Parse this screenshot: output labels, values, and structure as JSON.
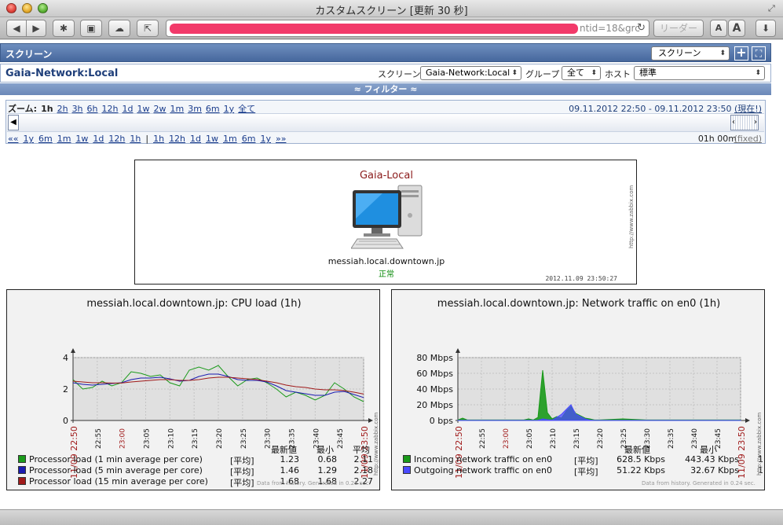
{
  "window": {
    "title": "カスタムスクリーン [更新 30 秒]"
  },
  "toolbar": {
    "back": "◀",
    "forward": "▶",
    "address_visible": "ntid=18&grc",
    "reader_label": "リーダー",
    "font_small": "A",
    "font_large": "A"
  },
  "header": {
    "title": "スクリーン",
    "screen_select": "スクリーン",
    "add_label": "+"
  },
  "filter": {
    "screen_name": "Gaia-Network:Local",
    "screen_label": "スクリーン",
    "screen_value": "Gaia-Network:Local",
    "group_label": "グループ",
    "group_value": "全て",
    "host_label": "ホスト",
    "host_value": "標準",
    "toggle_label": "≈ フィルター ≈"
  },
  "timebar": {
    "zoom_label": "ズーム:",
    "zoom_links": [
      "1h",
      "2h",
      "3h",
      "6h",
      "12h",
      "1d",
      "1w",
      "2w",
      "1m",
      "3m",
      "6m",
      "1y",
      "全て"
    ],
    "zoom_active": "1h",
    "range_start": "09.11.2012 22:50",
    "range_sep": "-",
    "range_end": "09.11.2012 23:50",
    "range_now": "(現在!)",
    "nav_left_start": "««",
    "nav_left": [
      "1y",
      "6m",
      "1m",
      "1w",
      "1d",
      "12h",
      "1h"
    ],
    "nav_sep": "|",
    "nav_right": [
      "1h",
      "12h",
      "1d",
      "1w",
      "1m",
      "6m",
      "1y"
    ],
    "nav_right_end": "»»",
    "period": "01h 00m",
    "fixed": "(fixed)"
  },
  "map": {
    "title": "Gaia-Local",
    "host": "messiah.local.downtown.jp",
    "status": "正常",
    "timestamp": "2012.11.09 23:50:27",
    "watermark": "http://www.zabbix.com"
  },
  "cpu_graph": {
    "title": "messiah.local.downtown.jp: CPU load (1h)",
    "col_last": "最新値",
    "col_min": "最小",
    "col_avg": "平均",
    "footer": "Data from history. Generated in 0.26 sec.",
    "watermark": "http://www.zabbix.com",
    "start_label": "11/09 22:50",
    "end_label": "11/09 23:50",
    "legend": [
      {
        "name": "Processor load (1 min average per core)",
        "func": "[平均]",
        "last": "1.23",
        "min": "0.68",
        "avg": "2.11",
        "color": "#1a9a1a"
      },
      {
        "name": "Processor load (5 min average per core)",
        "func": "[平均]",
        "last": "1.46",
        "min": "1.29",
        "avg": "2.18",
        "color": "#1a1ab0"
      },
      {
        "name": "Processor load (15 min average per core)",
        "func": "[平均]",
        "last": "1.68",
        "min": "1.68",
        "avg": "2.27",
        "color": "#a01a1a"
      }
    ]
  },
  "net_graph": {
    "title": "messiah.local.downtown.jp: Network traffic on en0 (1h)",
    "col_last": "最新値",
    "col_min": "最小",
    "footer": "Data from history. Generated in 0.24 sec.",
    "watermark": "http://www.zabbix.com",
    "start_label": "11/09 22:50",
    "end_label": "11/09 23:50",
    "legend": [
      {
        "name": "Incoming network traffic on en0",
        "func": "[平均]",
        "last": "628.5 Kbps",
        "min": "443.43 Kbps",
        "extra": "1",
        "color": "#1a9a1a"
      },
      {
        "name": "Outgoing network traffic on en0",
        "func": "[平均]",
        "last": "51.22 Kbps",
        "min": "32.67 Kbps",
        "extra": "1.",
        "color": "#4a4aff"
      }
    ]
  },
  "chart_data": [
    {
      "type": "line",
      "title": "messiah.local.downtown.jp: CPU load (1h)",
      "ylim": [
        0,
        4
      ],
      "yticks": [
        "0",
        "2",
        "4"
      ],
      "xticks": [
        "22:55",
        "23:00",
        "23:05",
        "23:10",
        "23:15",
        "23:20",
        "23:25",
        "23:30",
        "23:35",
        "23:40",
        "23:45"
      ],
      "x": [
        0,
        2,
        4,
        6,
        8,
        10,
        12,
        14,
        16,
        18,
        20,
        22,
        24,
        26,
        28,
        30,
        32,
        34,
        36,
        38,
        40,
        42,
        44,
        46,
        48,
        50,
        52,
        54,
        56,
        58,
        60
      ],
      "series": [
        {
          "name": "Processor load (1 min average per core)",
          "color": "#1a9a1a",
          "values": [
            2.6,
            2.0,
            2.1,
            2.5,
            2.2,
            2.4,
            3.1,
            3.0,
            2.8,
            2.9,
            2.4,
            2.2,
            3.2,
            3.4,
            3.2,
            3.5,
            2.8,
            2.2,
            2.6,
            2.7,
            2.4,
            2.0,
            1.5,
            1.8,
            1.6,
            1.3,
            1.6,
            2.4,
            2.0,
            1.5,
            1.2
          ]
        },
        {
          "name": "Processor load (5 min average per core)",
          "color": "#1a1ab0",
          "values": [
            2.4,
            2.3,
            2.25,
            2.3,
            2.35,
            2.4,
            2.6,
            2.7,
            2.7,
            2.75,
            2.65,
            2.5,
            2.55,
            2.8,
            2.95,
            2.95,
            2.8,
            2.6,
            2.55,
            2.55,
            2.45,
            2.2,
            1.9,
            1.8,
            1.7,
            1.6,
            1.6,
            1.8,
            1.85,
            1.65,
            1.46
          ]
        },
        {
          "name": "Processor load (15 min average per core)",
          "color": "#a01a1a",
          "values": [
            2.5,
            2.45,
            2.4,
            2.4,
            2.38,
            2.38,
            2.45,
            2.5,
            2.55,
            2.6,
            2.6,
            2.55,
            2.55,
            2.6,
            2.7,
            2.75,
            2.75,
            2.7,
            2.65,
            2.6,
            2.5,
            2.4,
            2.25,
            2.15,
            2.1,
            2.0,
            1.95,
            1.95,
            1.9,
            1.8,
            1.68
          ]
        }
      ]
    },
    {
      "type": "area",
      "title": "messiah.local.downtown.jp: Network traffic on en0 (1h)",
      "ylim": [
        0,
        80
      ],
      "yticks": [
        "0 bps",
        "20 Mbps",
        "40 Mbps",
        "60 Mbps",
        "80 Mbps"
      ],
      "xticks": [
        "22:55",
        "23:00",
        "23:05",
        "23:10",
        "23:15",
        "23:20",
        "23:25",
        "23:30",
        "23:35",
        "23:40",
        "23:45"
      ],
      "x": [
        0,
        1,
        2,
        3,
        4,
        5,
        6,
        7,
        8,
        9,
        10,
        11,
        12,
        13,
        14,
        15,
        16,
        17,
        18,
        19,
        20,
        21,
        22,
        23,
        24,
        25,
        26,
        27,
        28,
        29,
        30,
        35,
        40,
        45,
        50,
        55,
        60
      ],
      "series": [
        {
          "name": "Incoming network traffic on en0",
          "color": "#1a9a1a",
          "values": [
            0.6,
            3.0,
            0.6,
            0.6,
            0.6,
            0.6,
            0.6,
            0.6,
            0.6,
            0.6,
            0.6,
            0.6,
            0.6,
            0.6,
            0.6,
            2.0,
            0.6,
            4.0,
            64.0,
            10.0,
            2.0,
            5.0,
            3.0,
            12.0,
            18.0,
            9.0,
            6.0,
            3.0,
            2.0,
            0.6,
            0.6,
            2.0,
            0.6,
            0.6,
            0.6,
            0.6,
            0.6
          ]
        },
        {
          "name": "Outgoing network traffic on en0",
          "color": "#4a4aff",
          "values": [
            0.05,
            0.1,
            0.05,
            0.05,
            0.05,
            0.05,
            0.05,
            0.05,
            0.05,
            0.05,
            0.05,
            0.05,
            0.05,
            0.05,
            0.05,
            0.05,
            0.05,
            0.1,
            2.0,
            1.0,
            0.5,
            4.0,
            8.0,
            14.0,
            20.0,
            8.0,
            5.0,
            2.0,
            0.5,
            0.1,
            0.05,
            0.1,
            0.05,
            0.05,
            0.05,
            0.05,
            0.05
          ]
        }
      ]
    }
  ]
}
